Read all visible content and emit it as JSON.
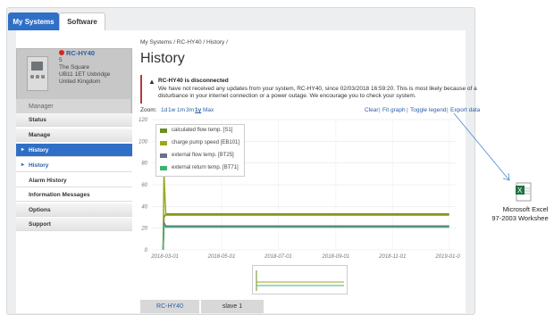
{
  "top_tabs": [
    "My Systems",
    "Software"
  ],
  "system": {
    "name": "RC-HY40",
    "address": [
      "5",
      "The Square",
      "UB11 1ET Uxbridge",
      "United Kingdom"
    ],
    "role": "Manager"
  },
  "sidebar": {
    "items": [
      {
        "label": "Status"
      },
      {
        "label": "Manage"
      },
      {
        "label": "History"
      },
      {
        "label": "History"
      },
      {
        "label": "Alarm History"
      },
      {
        "label": "Information Messages"
      },
      {
        "label": "Options"
      },
      {
        "label": "Support"
      }
    ]
  },
  "breadcrumb": "My Systems / RC-HY40 / History /",
  "page_title": "History",
  "alert": {
    "title": "RC-HY40 is disconnected",
    "line1": "We have not received any updates from your system, RC-HY40, since 02/03/2018 16:59:20. This is most likely because of a",
    "line2": "disturbance in your internet connection or a power outage. We encourage you to check your system."
  },
  "zoom": {
    "label": "Zoom:",
    "options": [
      "1d",
      "1w",
      "1m",
      "3m",
      "1y",
      "Max"
    ],
    "selected": "1y"
  },
  "chart_tools": [
    "Clear",
    "Fit graph",
    "Toggle legend",
    "Export data"
  ],
  "chart_data": {
    "type": "line",
    "y_ticks": [
      "0",
      "20",
      "40",
      "60",
      "80",
      "100",
      "120"
    ],
    "ylim": [
      0,
      120
    ],
    "x_ticks": [
      "2018-03-01",
      "2018-05-01",
      "2018-07-01",
      "2018-09-01",
      "2018-11-01",
      "2019-01-01"
    ],
    "series": [
      {
        "name": "calculated flow temp. [S1]",
        "color": "#6b8e23",
        "x": [
          "2018-02-27",
          "2018-02-28",
          "2018-03-02",
          "2019-01-01"
        ],
        "y": [
          0,
          30,
          33,
          33
        ]
      },
      {
        "name": "charge pump speed [EB101]",
        "color": "#9aa81e",
        "x": [
          "2018-02-27",
          "2018-02-28",
          "2018-03-02",
          "2019-01-01"
        ],
        "y": [
          0,
          70,
          32,
          32
        ]
      },
      {
        "name": "external flow temp. [BT25]",
        "color": "#6d6f8c",
        "x": [
          "2018-02-27",
          "2018-02-28",
          "2018-03-02",
          "2019-01-01"
        ],
        "y": [
          0,
          25,
          22,
          22
        ]
      },
      {
        "name": "external return temp. [BT71]",
        "color": "#3cb371",
        "x": [
          "2018-02-27",
          "2018-02-28",
          "2018-03-02",
          "2019-01-01"
        ],
        "y": [
          0,
          22,
          21,
          21
        ]
      }
    ],
    "legend": "top-left",
    "grid": true
  },
  "bottom_tabs": [
    "RC-HY40",
    "slave 1"
  ],
  "desktop_icon": {
    "label1": "Microsoft Excel",
    "label2": "97-2003 Workshee",
    "icon": "excel-file-icon"
  }
}
